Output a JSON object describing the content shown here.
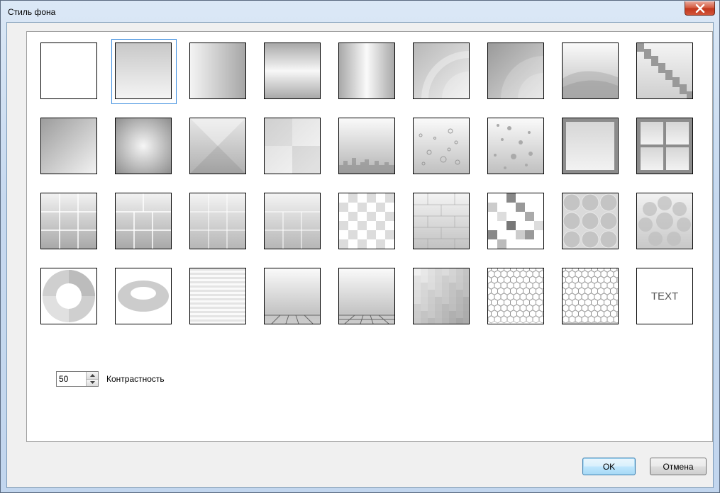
{
  "window": {
    "title": "Стиль фона",
    "close_symbol": "X"
  },
  "styles": [
    {
      "name": "plain-white",
      "selected": false
    },
    {
      "name": "vertical-gradient",
      "selected": true
    },
    {
      "name": "horizontal-gradient",
      "selected": false
    },
    {
      "name": "horizontal-band",
      "selected": false
    },
    {
      "name": "vertical-band",
      "selected": false
    },
    {
      "name": "arcs-light",
      "selected": false
    },
    {
      "name": "arcs-dark",
      "selected": false
    },
    {
      "name": "waves",
      "selected": false
    },
    {
      "name": "stairs",
      "selected": false
    },
    {
      "name": "diagonal-gradient",
      "selected": false
    },
    {
      "name": "radial-cross",
      "selected": false
    },
    {
      "name": "envelope",
      "selected": false
    },
    {
      "name": "quadrants",
      "selected": false
    },
    {
      "name": "city-skyline",
      "selected": false
    },
    {
      "name": "bubbles",
      "selected": false
    },
    {
      "name": "dots",
      "selected": false
    },
    {
      "name": "frame",
      "selected": false
    },
    {
      "name": "window-frame",
      "selected": false
    },
    {
      "name": "tiles-3x3",
      "selected": false
    },
    {
      "name": "tiles-offset",
      "selected": false
    },
    {
      "name": "tiles-grid-light",
      "selected": false
    },
    {
      "name": "tiles-bricks-light",
      "selected": false
    },
    {
      "name": "checkerboard",
      "selected": false
    },
    {
      "name": "bricks",
      "selected": false
    },
    {
      "name": "mosaic",
      "selected": false
    },
    {
      "name": "circles-3x3",
      "selected": false
    },
    {
      "name": "circles-ring",
      "selected": false
    },
    {
      "name": "donut",
      "selected": false
    },
    {
      "name": "ellipse-ring",
      "selected": false
    },
    {
      "name": "stripes",
      "selected": false
    },
    {
      "name": "floor-perspective",
      "selected": false
    },
    {
      "name": "floor-grid",
      "selected": false
    },
    {
      "name": "pixel-gradient",
      "selected": false
    },
    {
      "name": "hexagons",
      "selected": false
    },
    {
      "name": "hexagons-dark",
      "selected": false
    },
    {
      "name": "text",
      "selected": false,
      "label": "TEXT"
    }
  ],
  "contrast": {
    "value": "50",
    "label": "Контрастность"
  },
  "buttons": {
    "ok": "OK",
    "cancel": "Отмена"
  }
}
